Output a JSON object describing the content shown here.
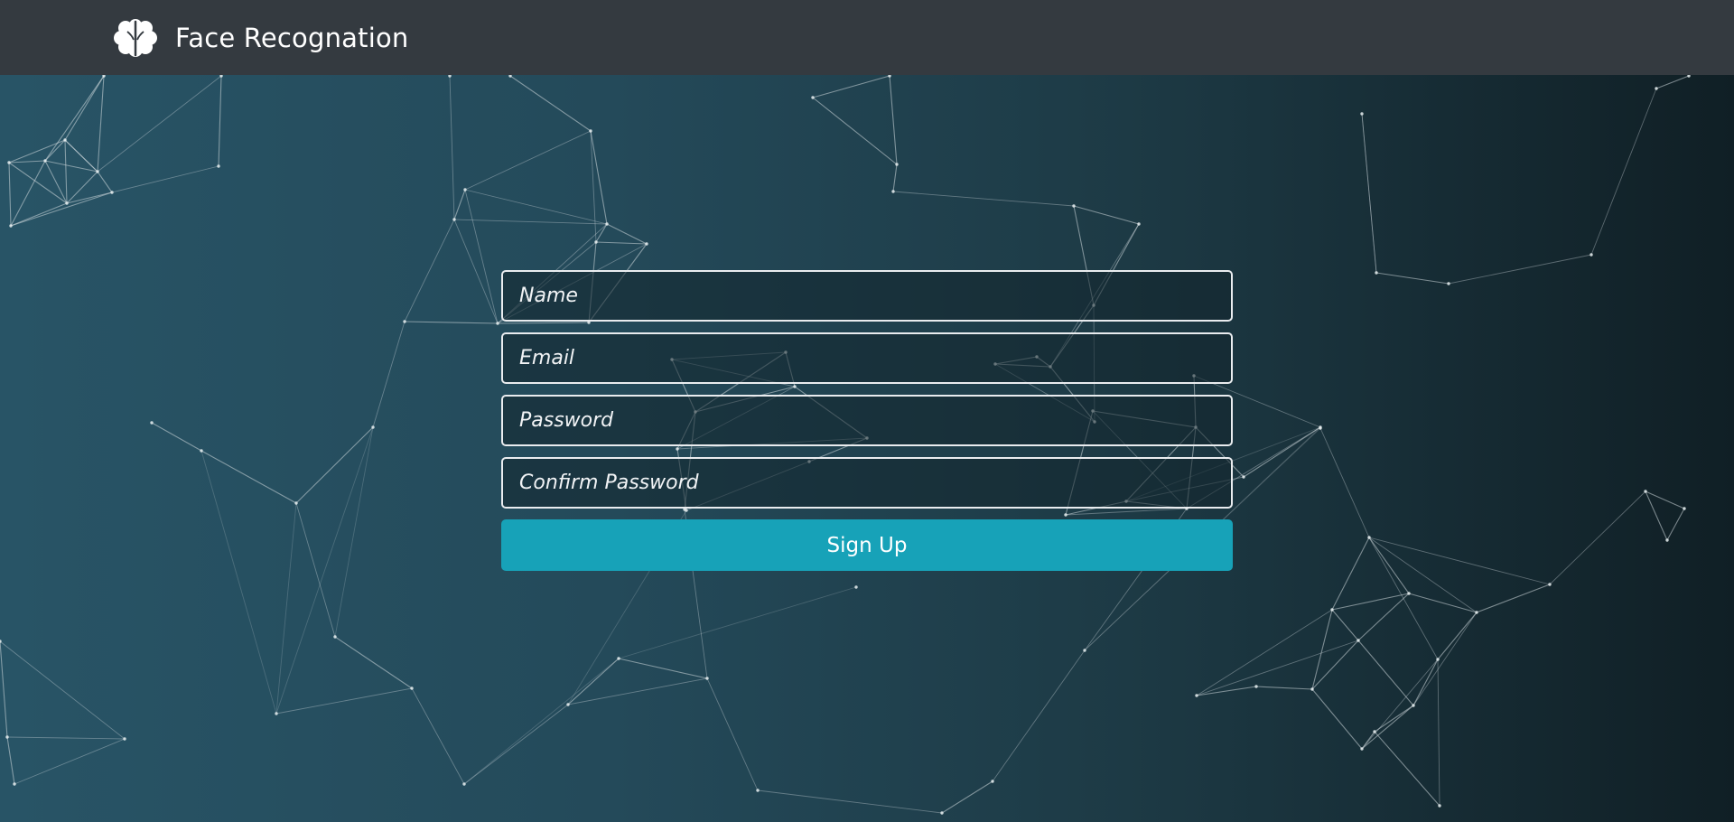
{
  "navbar": {
    "title": "Face Recognation",
    "logo_icon": "brain-icon"
  },
  "form": {
    "name_placeholder": "Name",
    "email_placeholder": "Email",
    "password_placeholder": "Password",
    "confirm_password_placeholder": "Confirm Password",
    "submit_label": "Sign Up"
  },
  "colors": {
    "navbar_bg": "#343a40",
    "button_bg": "#17a2b8",
    "background_left": "#285466",
    "background_right": "#101f25"
  }
}
